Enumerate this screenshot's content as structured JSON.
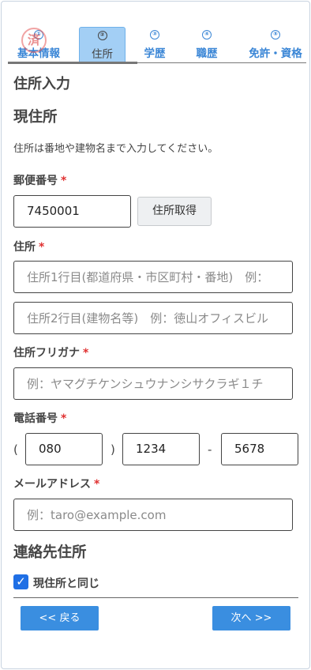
{
  "steps": [
    {
      "number": "①",
      "label": "基本情報"
    },
    {
      "number": "②",
      "label": "住所"
    },
    {
      "number": "③",
      "label": "学歴"
    },
    {
      "number": "④",
      "label": "職歴"
    },
    {
      "number": "⑤",
      "label": "免許・資格"
    }
  ],
  "seal_text": "済",
  "page_title": "住所入力",
  "current_address": {
    "heading": "現住所",
    "note": "住所は番地や建物名まで入力してください。",
    "postal": {
      "label": "郵便番号",
      "required": "*",
      "value": "7450001",
      "button": "住所取得"
    },
    "address": {
      "label": "住所",
      "required": "*",
      "line1_placeholder": "住所1行目(都道府県・市区町村・番地)　例：",
      "line2_placeholder": "住所2行目(建物名等)　例：徳山オフィスビル"
    },
    "furigana": {
      "label": "住所フリガナ",
      "required": "*",
      "placeholder": "例：ヤマグチケンシュウナンシサクラギ１チ"
    },
    "phone": {
      "label": "電話番号",
      "required": "*",
      "open_paren": "(",
      "close_paren": ")",
      "dash": "-",
      "part1": "080",
      "part2": "1234",
      "part3": "5678"
    },
    "email": {
      "label": "メールアドレス",
      "required": "*",
      "placeholder": "例：taro@example.com"
    }
  },
  "contact_address": {
    "heading": "連絡先住所",
    "same_checkbox_label": "現住所と同じ",
    "same_checked": true
  },
  "nav": {
    "back": "<< 戻る",
    "next": "次へ >>"
  },
  "colors": {
    "accent": "#3a8ee0",
    "active_tab": "#a3cff5",
    "required": "#e03131",
    "checkbox": "#1f6fe5"
  }
}
